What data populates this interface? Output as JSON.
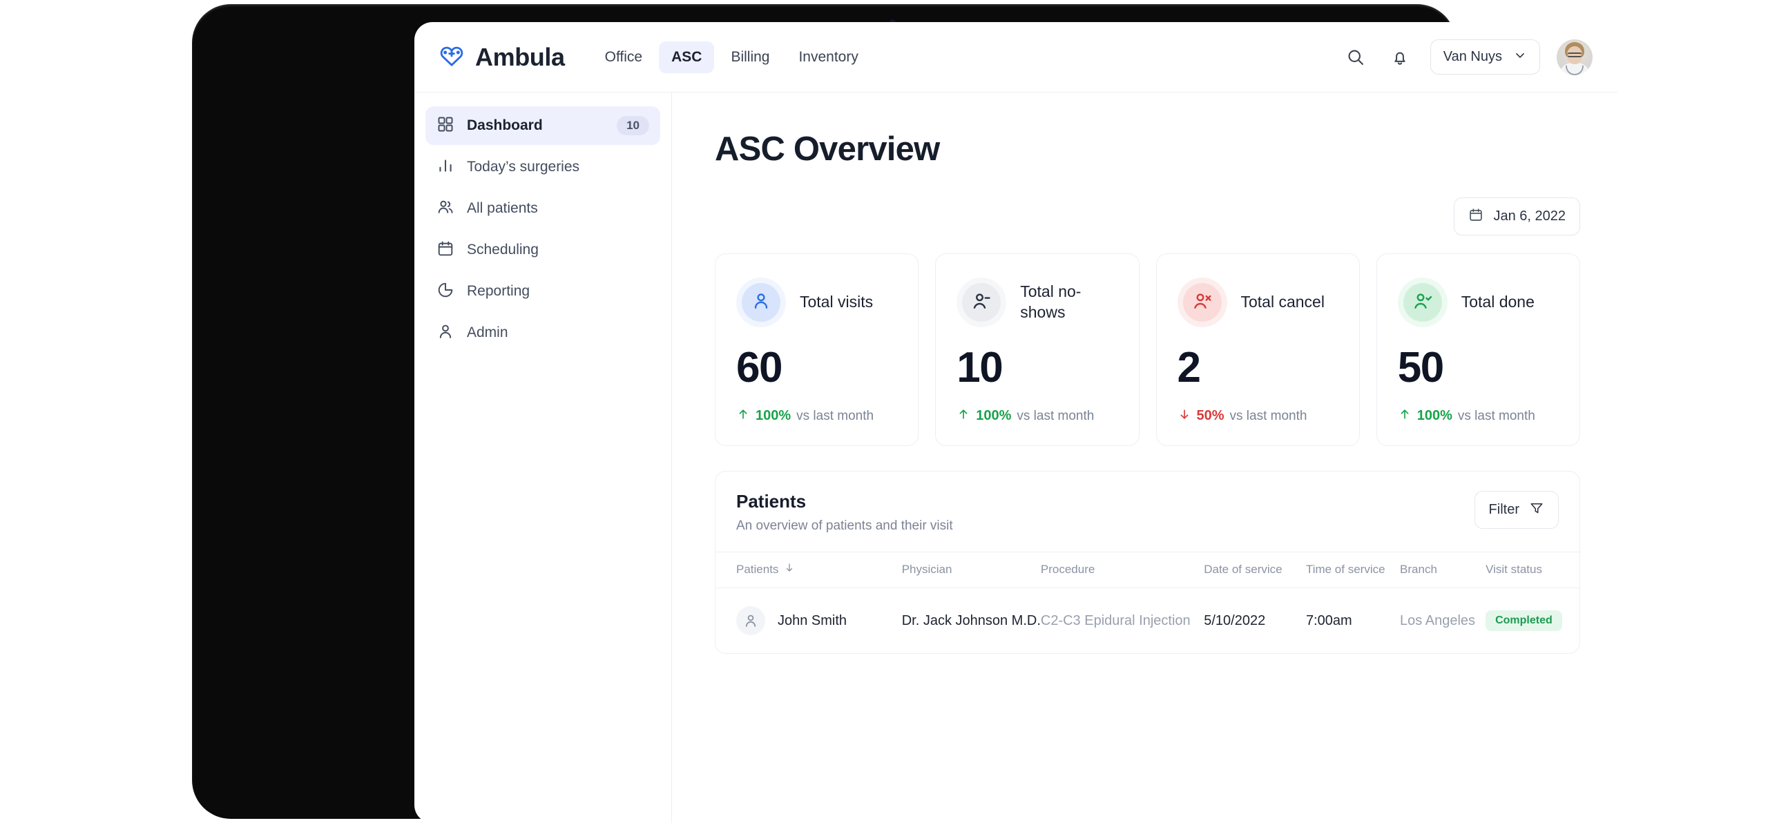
{
  "brand": {
    "name": "Ambula",
    "logo_icon": "heart-stethoscope-icon",
    "color": "#2a6ce4"
  },
  "topbar": {
    "tabs": [
      {
        "label": "Office",
        "active": false
      },
      {
        "label": "ASC",
        "active": true
      },
      {
        "label": "Billing",
        "active": false
      },
      {
        "label": "Inventory",
        "active": false
      }
    ],
    "search_icon": "search-icon",
    "notifications_icon": "bell-icon",
    "branch": {
      "label": "Van Nuys",
      "chevron_icon": "chevron-down-icon"
    },
    "avatar_alt": "user-avatar"
  },
  "sidebar": {
    "items": [
      {
        "label": "Dashboard",
        "icon": "grid-icon",
        "badge": "10",
        "active": true
      },
      {
        "label": "Today’s surgeries",
        "icon": "bar-chart-icon",
        "badge": null,
        "active": false
      },
      {
        "label": "All patients",
        "icon": "users-icon",
        "badge": null,
        "active": false
      },
      {
        "label": "Scheduling",
        "icon": "calendar-icon",
        "badge": null,
        "active": false
      },
      {
        "label": "Reporting",
        "icon": "pie-chart-icon",
        "badge": null,
        "active": false
      },
      {
        "label": "Admin",
        "icon": "user-icon",
        "badge": null,
        "active": false
      }
    ]
  },
  "main": {
    "page_title": "ASC Overview",
    "datepicker": {
      "label": "Jan 6, 2022",
      "icon": "calendar-icon"
    }
  },
  "stats": [
    {
      "title": "Total visits",
      "value": "60",
      "delta_pct": "100%",
      "delta_note": "vs last month",
      "direction": "up",
      "icon": "user-icon",
      "accent": "#2a6ce4",
      "halo": "#e8effd",
      "bubble": "#d7e4fb"
    },
    {
      "title": "Total no-shows",
      "value": "10",
      "delta_pct": "100%",
      "delta_note": "vs last month",
      "direction": "up",
      "icon": "user-minus-icon",
      "accent": "#2b3343",
      "halo": "#f3f4f6",
      "bubble": "#eaecf0"
    },
    {
      "title": "Total cancel",
      "value": "2",
      "delta_pct": "50%",
      "delta_note": "vs last month",
      "direction": "down",
      "icon": "user-x-icon",
      "accent": "#d93a3a",
      "halo": "#fdeaea",
      "bubble": "#fbd9d9"
    },
    {
      "title": "Total done",
      "value": "50",
      "delta_pct": "100%",
      "delta_note": "vs last month",
      "direction": "up",
      "icon": "user-check-icon",
      "accent": "#17a34a",
      "halo": "#e6f8ec",
      "bubble": "#d1f0dc"
    }
  ],
  "patients": {
    "title": "Patients",
    "subtitle": "An overview of patients and their visit",
    "filter": {
      "label": "Filter",
      "icon": "filter-icon"
    },
    "columns": [
      "Patients",
      "Physician",
      "Procedure",
      "Date of service",
      "Time of service",
      "Branch",
      "Visit status"
    ],
    "sort_icon": "arrow-down-icon",
    "rows": [
      {
        "patient": "John Smith",
        "physician": "Dr. Jack Johnson M.D.",
        "procedure": "C2-C3 Epidural Injection",
        "date_of_service": "5/10/2022",
        "time_of_service": "7:00am",
        "branch": "Los Angeles",
        "visit_status": "Completed"
      }
    ]
  },
  "colors": {
    "up": "#17a34a",
    "down": "#d93a3a",
    "accent": "#2a6ce4",
    "badge_completed_bg": "#e4f7ea",
    "badge_completed_fg": "#1d9a52"
  }
}
